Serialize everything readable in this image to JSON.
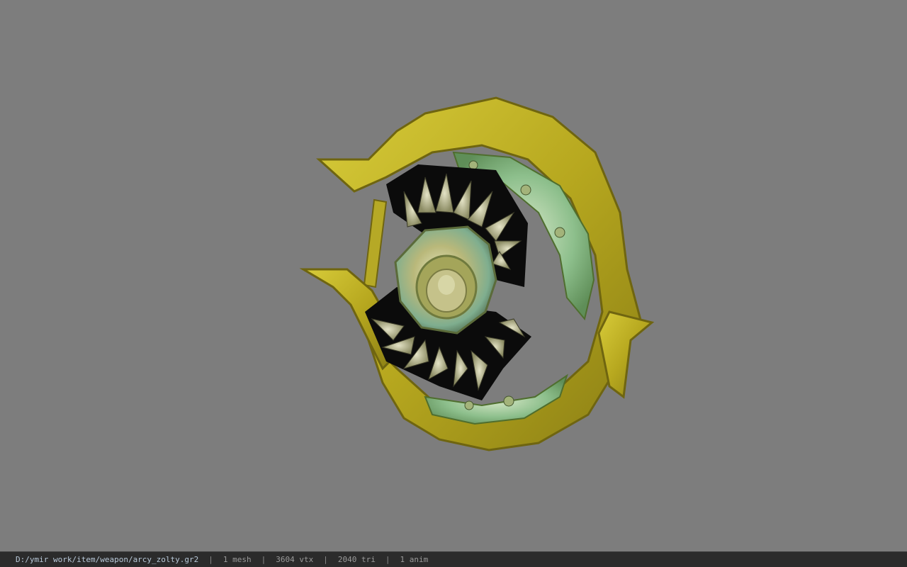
{
  "viewer": {
    "background_color": "#7d7d7d",
    "model_name": "golden circular chakram blade",
    "model_colors": {
      "gold": "#c9bb2a",
      "gold_dark": "#6f6510",
      "jade": "#8fc08a",
      "center_black": "#0a0a0a",
      "petal": "#b9b99a"
    }
  },
  "status": {
    "path": "D:/ymir work/item/weapon/arcy_zolty.gr2",
    "separator": "|",
    "mesh": "1 mesh",
    "vtx": "3604 vtx",
    "tri": "2040 tri",
    "anim": "1 anim"
  }
}
